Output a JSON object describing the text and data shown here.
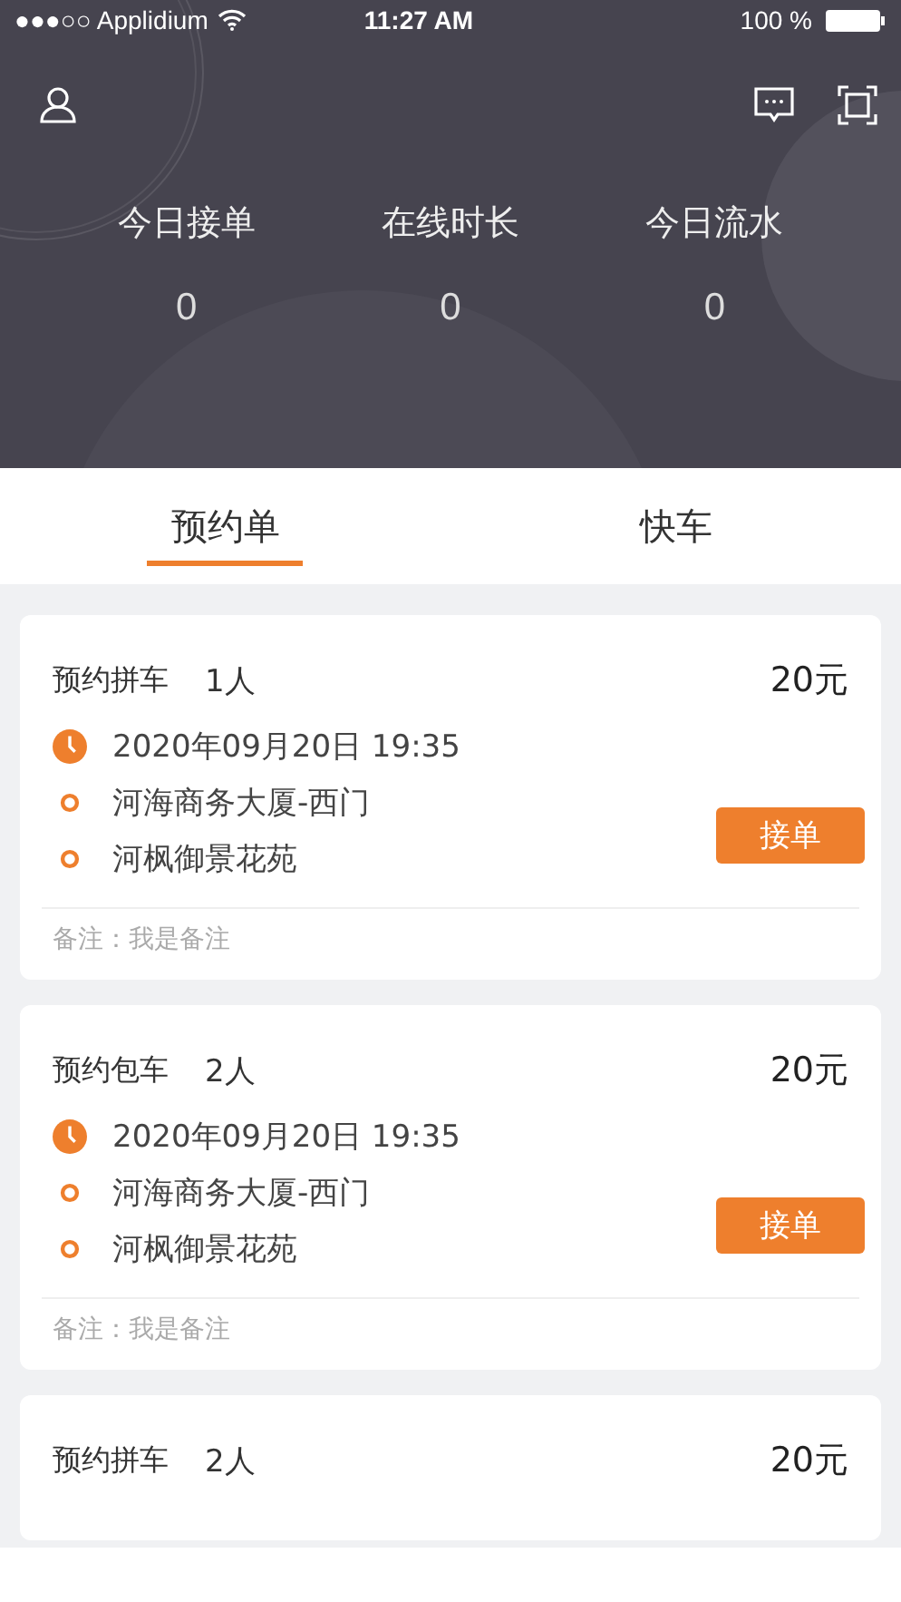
{
  "status_bar": {
    "carrier": "●●●○○ Applidium",
    "time": "11:27 AM",
    "battery": "100 %"
  },
  "stats": [
    {
      "label": "今日接单",
      "value": "0"
    },
    {
      "label": "在线时长",
      "value": "0"
    },
    {
      "label": "今日流水",
      "value": "0"
    }
  ],
  "tabs": [
    {
      "label": "预约单",
      "selected": true
    },
    {
      "label": "快车",
      "selected": false
    }
  ],
  "orders": [
    {
      "type": "预约拼车",
      "passengers": "1人",
      "price": "20元",
      "time": "2020年09月20日 19:35",
      "from": "河海商务大厦-西门",
      "to": "河枫御景花苑",
      "button": "接单",
      "note": "备注：我是备注"
    },
    {
      "type": "预约包车",
      "passengers": "2人",
      "price": "20元",
      "time": "2020年09月20日 19:35",
      "from": "河海商务大厦-西门",
      "to": "河枫御景花苑",
      "button": "接单",
      "note": "备注：我是备注"
    },
    {
      "type": "预约拼车",
      "passengers": "2人",
      "price": "20元"
    }
  ]
}
